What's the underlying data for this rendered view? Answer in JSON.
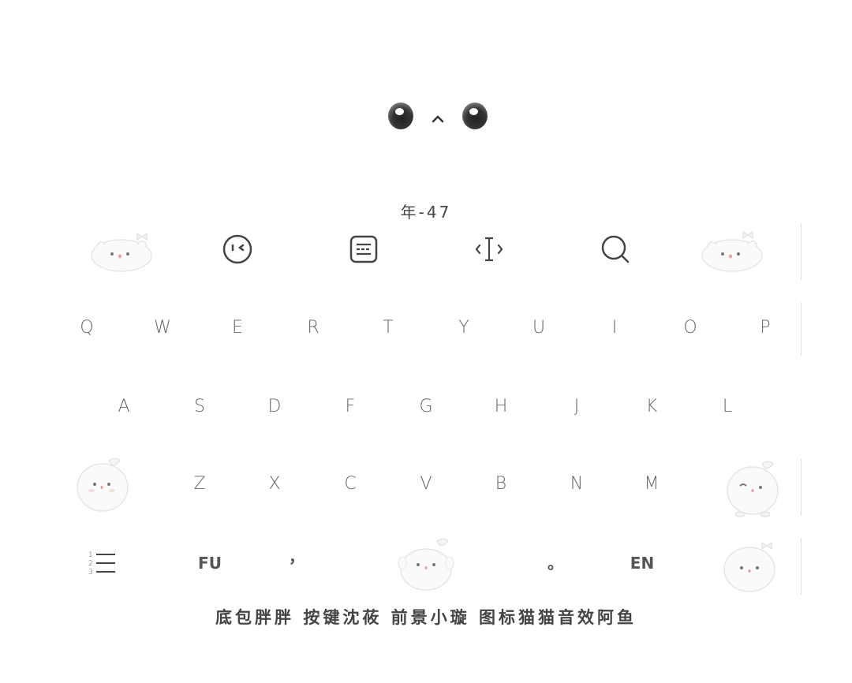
{
  "keyboard_code": "年-47",
  "toolbar": {
    "icons": [
      "emoji-icon",
      "clipboard-icon",
      "cursor-icon",
      "search-icon"
    ]
  },
  "rows": {
    "row1": [
      "Q",
      "W",
      "E",
      "R",
      "T",
      "Y",
      "U",
      "I",
      "O",
      "P"
    ],
    "row2": [
      "A",
      "S",
      "D",
      "F",
      "G",
      "H",
      "J",
      "K",
      "L"
    ],
    "row3": [
      "Z",
      "X",
      "C",
      "V",
      "B",
      "N",
      "M"
    ]
  },
  "bottom": {
    "fu_label": "FU",
    "comma_label": "，",
    "period_label": "。",
    "en_label": "EN",
    "numbers_menu": [
      "1",
      "2",
      "3"
    ]
  },
  "credits": "底包胖胖 按键沈莜 前景小璇 图标猫猫音效阿鱼"
}
